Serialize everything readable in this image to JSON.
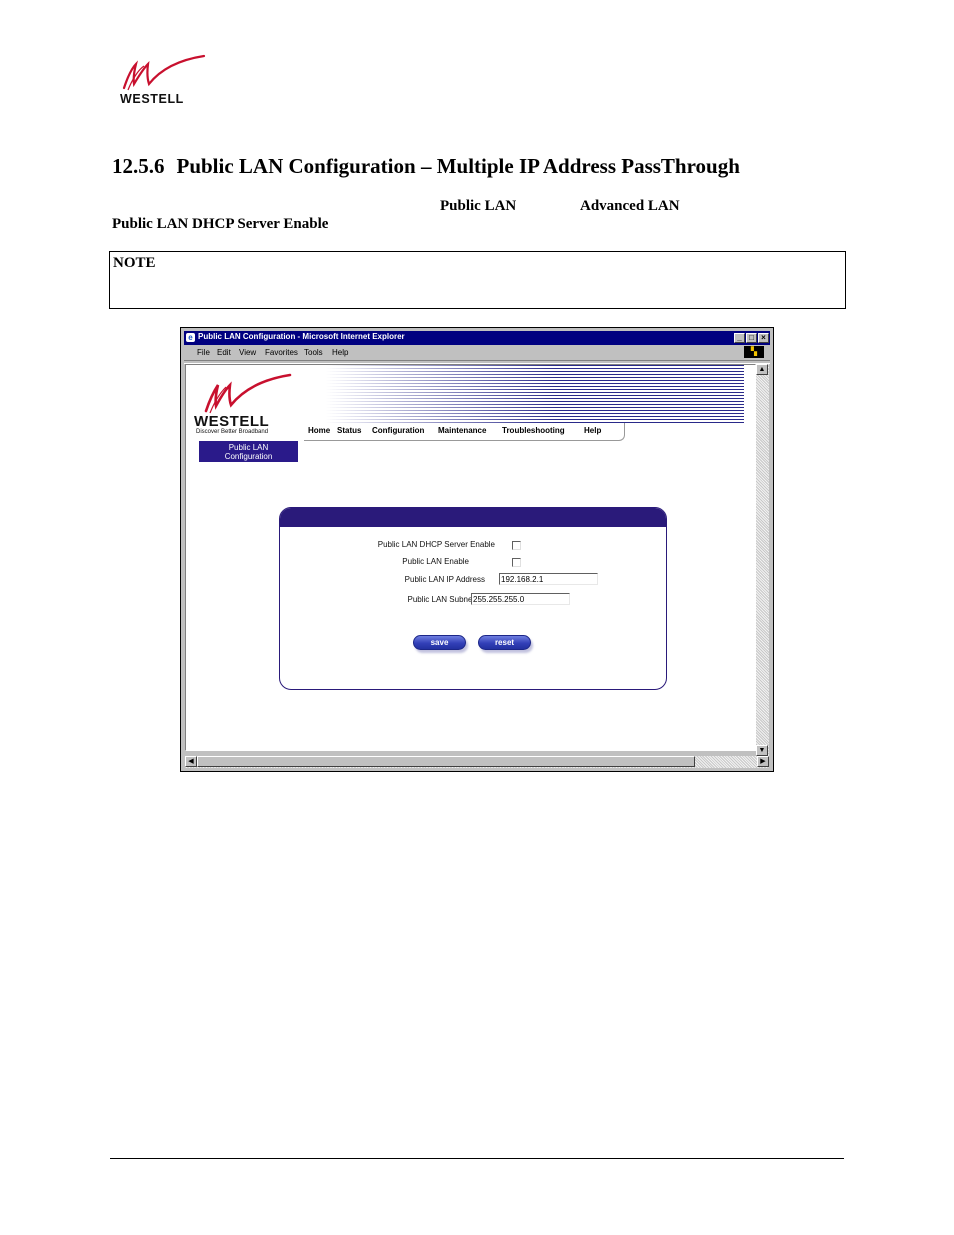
{
  "page": {
    "logo_text": "WESTELL",
    "section_number": "12.5.6",
    "section_title": "Public LAN Configuration – Multiple IP Address PassThrough",
    "terms": {
      "public_lan": "Public LAN",
      "advanced_lan": "Advanced LAN",
      "dhcp_enable": "Public LAN DHCP Server Enable"
    },
    "note_label": "NOTE"
  },
  "browser": {
    "title": "Public LAN Configuration - Microsoft Internet Explorer",
    "menu": [
      "File",
      "Edit",
      "View",
      "Favorites",
      "Tools",
      "Help"
    ],
    "window_buttons": {
      "minimize": "_",
      "maximize": "□",
      "close": "×"
    }
  },
  "web": {
    "brand": "WESTELL",
    "tagline": "Discover  Better  Broadband",
    "nav": [
      "Home",
      "Status",
      "Configuration",
      "Maintenance",
      "Troubleshooting",
      "Help"
    ],
    "page_tab_line1": "Public LAN",
    "page_tab_line2": "Configuration",
    "form": {
      "dhcp_label": "Public LAN DHCP Server Enable",
      "enable_label": "Public LAN Enable",
      "ip_label": "Public LAN IP Address",
      "ip_value": "192.168.2.1",
      "mask_label": "Public LAN Subnet Mask",
      "mask_value": "255.255.255.0",
      "save_label": "save",
      "reset_label": "reset"
    }
  },
  "colors": {
    "title_bar": "#000080",
    "panel_header": "#2a1a7a",
    "page_tab": "#2a1a8a",
    "button": "#3340b8",
    "logo_red": "#c8102e"
  }
}
